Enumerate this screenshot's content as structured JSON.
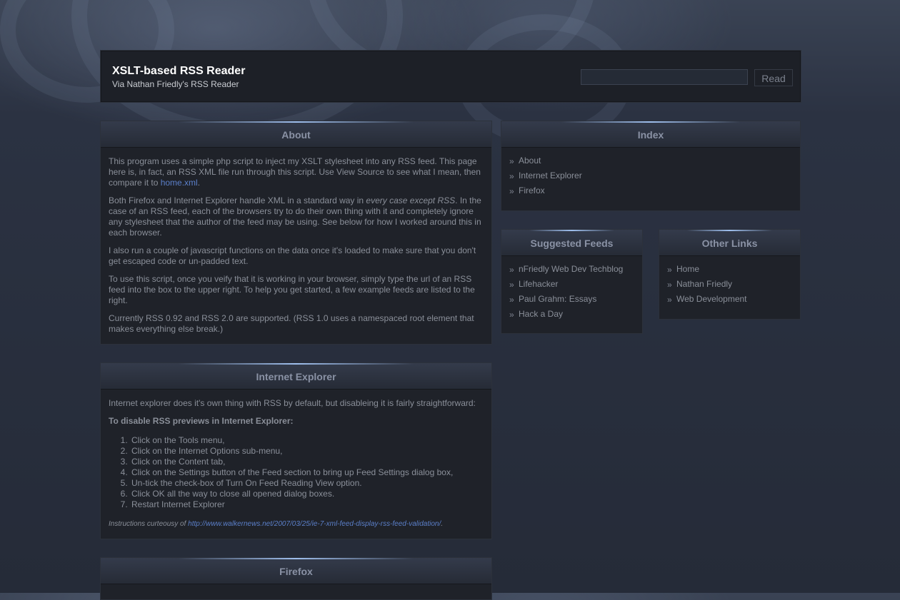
{
  "header": {
    "title": "XSLT-based RSS Reader",
    "subtitle": "Via Nathan Friedly's RSS Reader",
    "search_value": "",
    "read_label": "Read"
  },
  "about": {
    "heading": "About",
    "p1_text": "This program uses a simple php script to inject my XSLT stylesheet into any RSS feed. This page here is, in fact, an RSS XML file run through this script. Use View Source to see what I mean, then compare it to ",
    "p1_link": "home.xml",
    "p1_end": ".",
    "p2_start": "Both Firefox and Internet Explorer handle XML in a standard way in ",
    "p2_em": "every case except RSS",
    "p2_end": ". In the case of an RSS feed, each of the browsers try to do their own thing with it and completely ignore any stylesheet that the author of the feed may be using. See below for how I worked around this in each browser.",
    "p3": "I also run a couple of javascript functions on the data once it's loaded to make sure that you don't get escaped code or un-padded text.",
    "p4": "To use this script, once you veify that it is working in your browser, simply type the url of an RSS feed into the box to the upper right. To help you get started, a few example feeds are listed to the right.",
    "p5": "Currently RSS 0.92 and RSS 2.0 are supported. (RSS 1.0 uses a namespaced root element that makes everything else break.)"
  },
  "ie": {
    "heading": "Internet Explorer",
    "intro": "Internet explorer does it's own thing with RSS by default, but disableing it is fairly straightforward:",
    "subheading": "To disable RSS previews in Internet Explorer:",
    "steps": [
      "Click on the Tools menu,",
      "Click on the Internet Options sub-menu,",
      "Click on the Content tab,",
      "Click on the Settings button of the Feed section to bring up Feed Settings dialog box,",
      "Un-tick the check-box of Turn On Feed Reading View option.",
      "Click OK all the way to close all opened dialog boxes.",
      "Restart Internet Explorer"
    ],
    "credit_prefix": "Instructions curteousy of ",
    "credit_link": "http://www.walkernews.net/2007/03/25/ie-7-xml-feed-display-rss-feed-validation/",
    "credit_end": "."
  },
  "firefox": {
    "heading": "Firefox"
  },
  "index": {
    "heading": "Index",
    "items": [
      "About",
      "Internet Explorer",
      "Firefox"
    ]
  },
  "suggested": {
    "heading": "Suggested Feeds",
    "items": [
      "nFriedly Web Dev Techblog",
      "Lifehacker",
      "Paul Grahm: Essays",
      "Hack a Day"
    ]
  },
  "other": {
    "heading": "Other Links",
    "items": [
      "Home",
      "Nathan Friedly",
      "Web Development"
    ]
  },
  "colors": {
    "background": "#2a3140",
    "panel": "#1f2229",
    "link": "#5b7fc9",
    "heading_text": "#8a92a5"
  }
}
